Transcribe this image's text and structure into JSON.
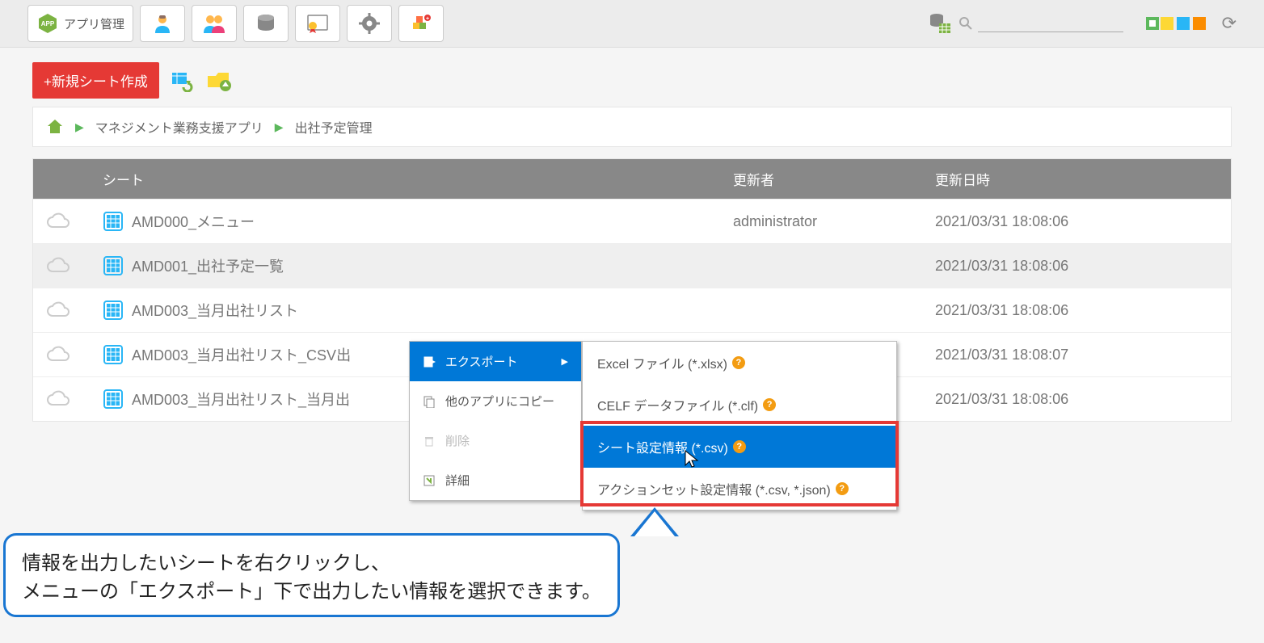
{
  "topbar": {
    "app_mgmt_label": "アプリ管理"
  },
  "action_row": {
    "new_sheet_label": "+新規シート作成"
  },
  "breadcrumb": {
    "level1": "マネジメント業務支援アプリ",
    "level2": "出社予定管理"
  },
  "table": {
    "headers": {
      "sheet": "シート",
      "updater": "更新者",
      "updated_at": "更新日時"
    },
    "rows": [
      {
        "name": "AMD000_メニュー",
        "updater": "administrator",
        "updated_at": "2021/03/31 18:08:06",
        "selected": false
      },
      {
        "name": "AMD001_出社予定一覧",
        "updater": "",
        "updated_at": "2021/03/31 18:08:06",
        "selected": true
      },
      {
        "name": "AMD003_当月出社リスト",
        "updater": "",
        "updated_at": "2021/03/31 18:08:06",
        "selected": false
      },
      {
        "name": "AMD003_当月出社リスト_CSV出",
        "updater": "",
        "updated_at": "2021/03/31 18:08:07",
        "selected": false
      },
      {
        "name": "AMD003_当月出社リスト_当月出",
        "updater": "",
        "updated_at": "2021/03/31 18:08:06",
        "selected": false
      }
    ]
  },
  "context_menu": {
    "export": "エクスポート",
    "copy_to_other": "他のアプリにコピー",
    "delete": "削除",
    "detail": "詳細"
  },
  "submenu": {
    "excel": "Excel ファイル (*.xlsx)",
    "celf": "CELF データファイル (*.clf)",
    "sheet_csv": "シート設定情報 (*.csv)",
    "actionset": "アクションセット設定情報 (*.csv, *.json)"
  },
  "callout": {
    "line1": "情報を出力したいシートを右クリックし、",
    "line2": "メニューの「エクスポート」下で出力したい情報を選択できます。"
  }
}
